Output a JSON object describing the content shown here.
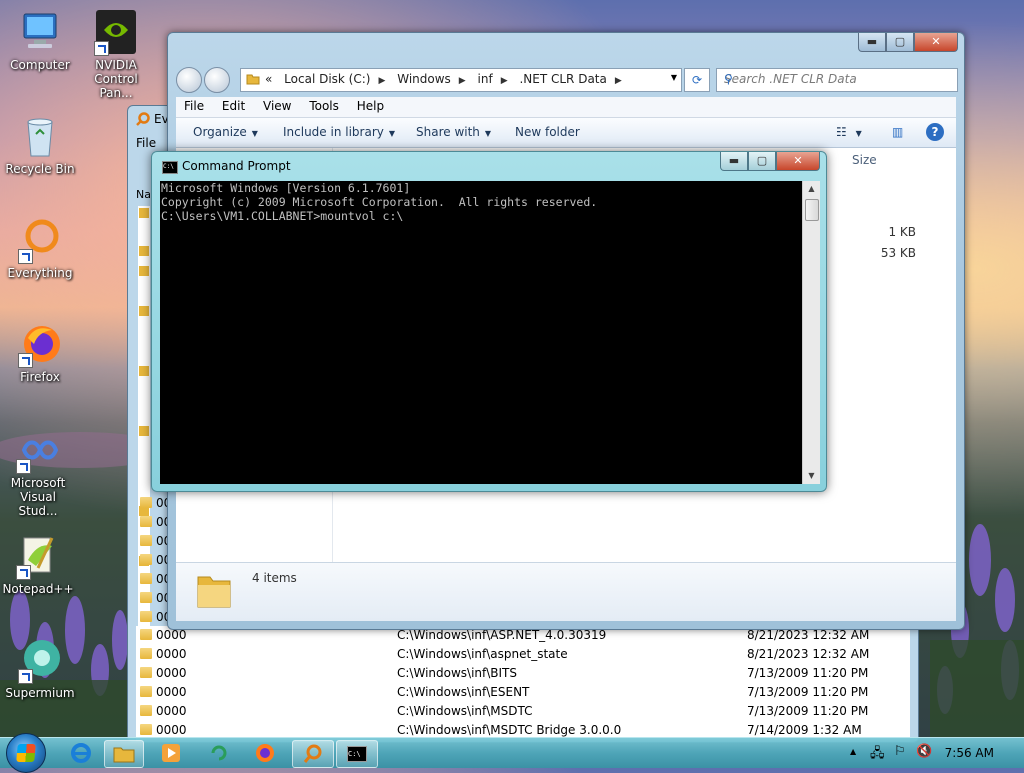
{
  "desktop": {
    "icons": [
      {
        "label": "Computer"
      },
      {
        "label": "NVIDIA Control Pan..."
      },
      {
        "label": "Recycle Bin"
      },
      {
        "label": "Everything"
      },
      {
        "label": "Firefox"
      },
      {
        "label": "Microsoft Visual Stud..."
      },
      {
        "label": "Notepad++"
      },
      {
        "label": "Supermium"
      }
    ]
  },
  "explorer": {
    "breadcrumb": {
      "prefix": "«",
      "items": [
        "Local Disk (C:)",
        "Windows",
        "inf",
        ".NET CLR Data"
      ]
    },
    "search_placeholder": "Search .NET CLR Data",
    "menu": [
      "File",
      "Edit",
      "View",
      "Tools",
      "Help"
    ],
    "commands": {
      "organize": "Organize",
      "include": "Include in library",
      "share": "Share with",
      "new_folder": "New folder"
    },
    "column_size": "Size",
    "sizes": [
      "1 KB",
      "53 KB"
    ],
    "details_count": "4 items",
    "buttons": {
      "min": "▬",
      "max": "▢",
      "close": "✕"
    }
  },
  "everything": {
    "title": "Ev",
    "menu_partial": "File",
    "left_partial": "Na",
    "rows": [
      {
        "name": "0000",
        "path": "C:\\Windows\\inf\\ASP.NET_4.0.30319",
        "date": "8/21/2023 12:32 AM"
      },
      {
        "name": "0000",
        "path": "C:\\Windows\\inf\\aspnet_state",
        "date": "8/21/2023 12:32 AM"
      },
      {
        "name": "0000",
        "path": "C:\\Windows\\inf\\BITS",
        "date": "7/13/2009 11:20 PM"
      },
      {
        "name": "0000",
        "path": "C:\\Windows\\inf\\ESENT",
        "date": "7/13/2009 11:20 PM"
      },
      {
        "name": "0000",
        "path": "C:\\Windows\\inf\\MSDTC",
        "date": "7/13/2009 11:20 PM"
      },
      {
        "name": "0000",
        "path": "C:\\Windows\\inf\\MSDTC Bridge 3.0.0.0",
        "date": "7/14/2009 1:32 AM"
      }
    ],
    "partial_rows": [
      "00",
      "00",
      "00",
      "00",
      "00",
      "00",
      "00"
    ]
  },
  "cmd": {
    "title": "Command Prompt",
    "icon_text": "C:\\",
    "line1": "Microsoft Windows [Version 6.1.7601]",
    "line2": "Copyright (c) 2009 Microsoft Corporation.  All rights reserved.",
    "line3": "",
    "line4": "C:\\Users\\VM1.COLLABNET>mountvol c:\\",
    "buttons": {
      "min": "▬",
      "max": "▢",
      "close": "✕"
    }
  },
  "taskbar": {
    "clock": "7:56 AM",
    "cmd_task_label": "C:\\"
  }
}
